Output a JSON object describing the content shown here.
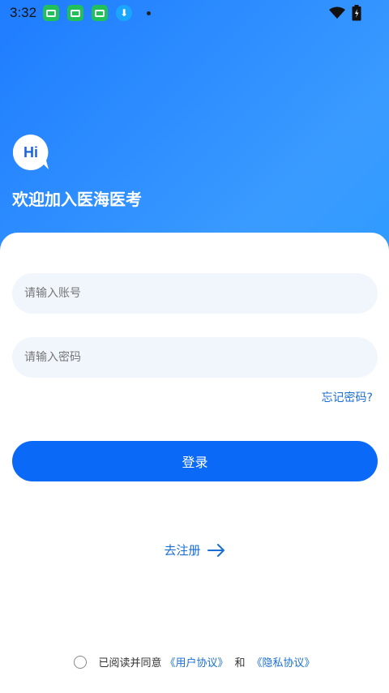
{
  "status_bar": {
    "time": "3:32",
    "icons": [
      "app-notification-icon",
      "app-notification-icon",
      "app-notification-icon",
      "download-icon",
      "dot-icon"
    ],
    "right_icons": [
      "wifi-icon",
      "battery-icon"
    ]
  },
  "header": {
    "bubble_text": "Hi",
    "welcome": "欢迎加入医海医考"
  },
  "form": {
    "account_placeholder": "请输入账号",
    "password_placeholder": "请输入密码",
    "forgot": "忘记密码?",
    "login": "登录",
    "register": "去注册"
  },
  "agreement": {
    "prefix": "已阅读并同意",
    "user_agreement": "《用户协议》",
    "and": "和",
    "privacy_agreement": "《隐私协议》"
  },
  "colors": {
    "primary": "#0a6af7",
    "link": "#1a6fd6",
    "input_bg": "#f1f6fd"
  }
}
